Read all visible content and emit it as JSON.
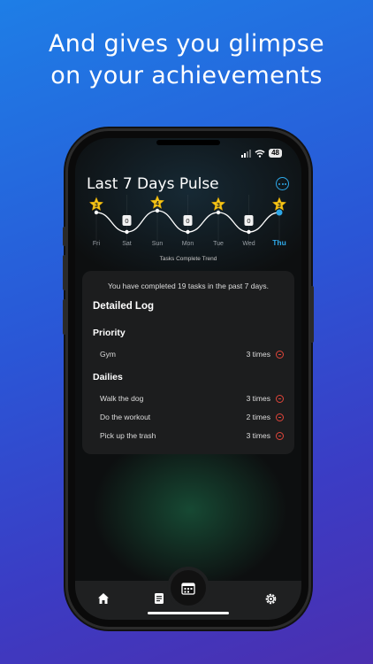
{
  "headline": {
    "line1": "And gives you glimpse",
    "line2": "on your achievements"
  },
  "status_bar": {
    "battery": "48"
  },
  "screen_title": "Last 7 Days Pulse",
  "chart_data": {
    "type": "line",
    "categories": [
      "Fri",
      "Sat",
      "Sun",
      "Mon",
      "Tue",
      "Wed",
      "Thu"
    ],
    "values": [
      3,
      0,
      4,
      0,
      3,
      0,
      3
    ],
    "highlight_index": 6,
    "caption": "Tasks Complete Trend",
    "colors": {
      "line": "#ffffff",
      "star": "#f5c518",
      "highlight": "#2ea8e8"
    }
  },
  "summary": "You have completed 19 tasks in the past 7 days.",
  "log": {
    "heading": "Detailed Log",
    "sections": [
      {
        "title": "Priority",
        "items": [
          {
            "name": "Gym",
            "count": "3 times"
          }
        ]
      },
      {
        "title": "Dailies",
        "items": [
          {
            "name": "Walk the dog",
            "count": "3 times"
          },
          {
            "name": "Do the workout",
            "count": "2 times"
          },
          {
            "name": "Pick up the trash",
            "count": "3 times"
          }
        ]
      }
    ]
  },
  "tabbar": {
    "icons": [
      "home-icon",
      "notes-icon",
      "calendar-icon",
      "settings-icon"
    ]
  }
}
